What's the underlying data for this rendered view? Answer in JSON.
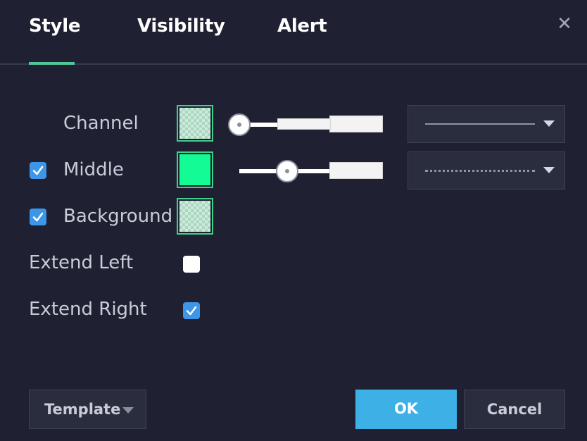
{
  "tabs": [
    {
      "label": "Style",
      "active": true
    },
    {
      "label": "Visibility",
      "active": false
    },
    {
      "label": "Alert",
      "active": false
    }
  ],
  "close_icon": "close-icon",
  "rows": {
    "channel": {
      "label": "Channel",
      "color": "#a8d8bf",
      "transparent": true,
      "line_style": "solid",
      "opacity_fraction": 0.0
    },
    "middle": {
      "label": "Middle",
      "checked": true,
      "color": "#13fb95",
      "line_style": "dotted",
      "opacity_fraction": 0.33
    },
    "background": {
      "label": "Background",
      "checked": true,
      "color": "#a8d8bf",
      "transparent": true
    },
    "extend_left": {
      "label": "Extend Left",
      "checked": false
    },
    "extend_right": {
      "label": "Extend Right",
      "checked": true
    }
  },
  "footer": {
    "template_label": "Template",
    "ok_label": "OK",
    "cancel_label": "Cancel"
  },
  "colors": {
    "background": "#1f2133",
    "accent_tab": "#4fc695",
    "checkbox": "#3d96e8",
    "ok_button": "#3db1e6"
  }
}
